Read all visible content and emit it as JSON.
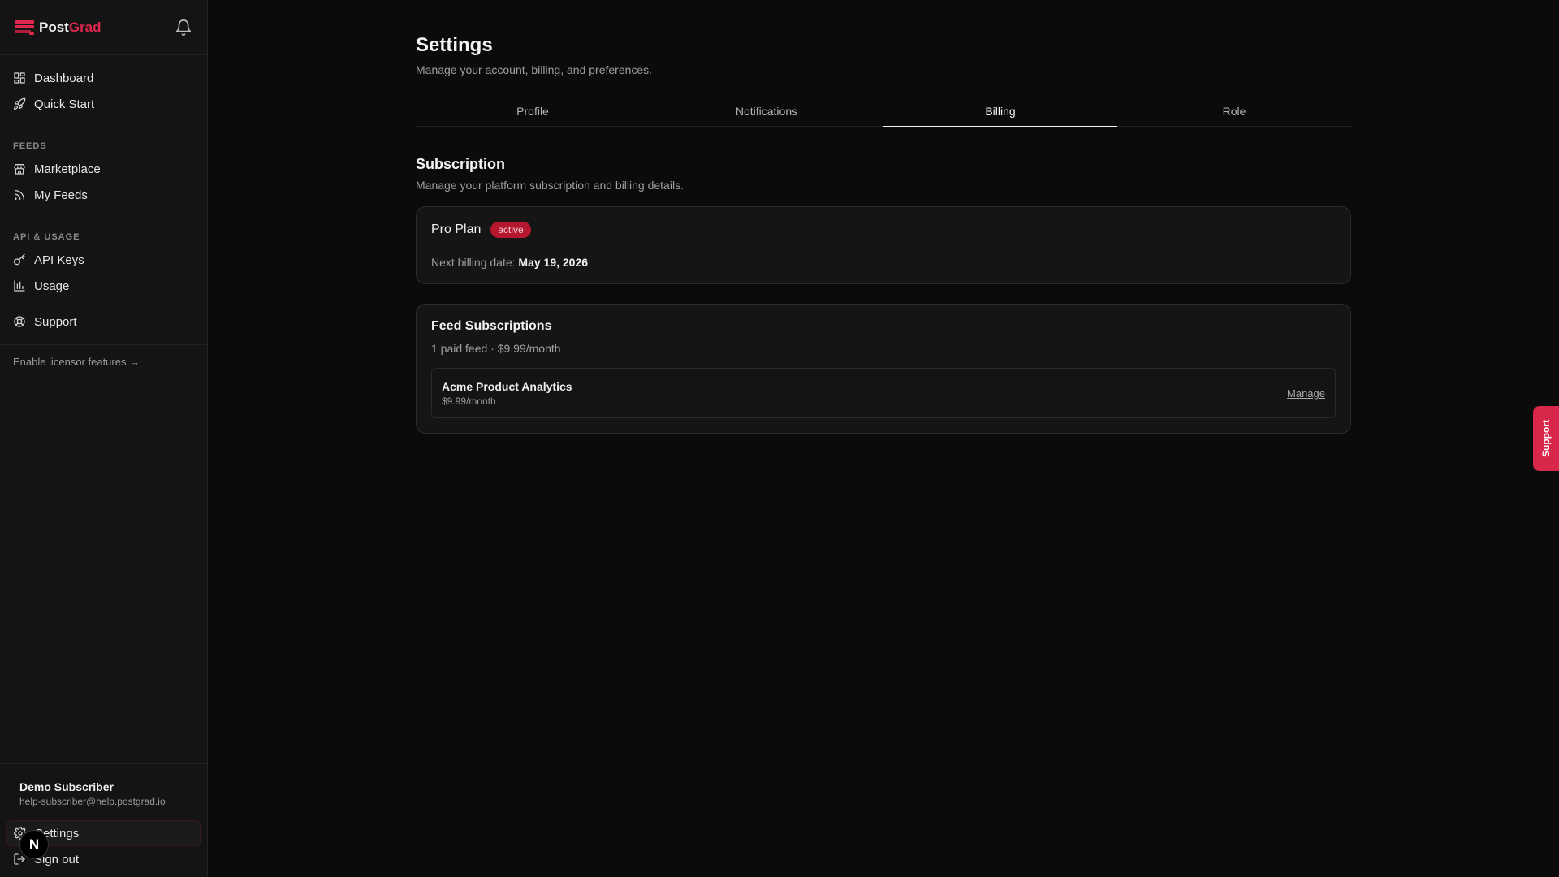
{
  "brand": {
    "name_part1": "Post",
    "name_part2": "Grad",
    "accent": "#e0284f"
  },
  "sidebar": {
    "top_items": [
      {
        "label": "Dashboard",
        "icon": "dashboard-icon"
      },
      {
        "label": "Quick Start",
        "icon": "rocket-icon"
      }
    ],
    "feeds_label": "FEEDS",
    "feeds_items": [
      {
        "label": "Marketplace",
        "icon": "store-icon"
      },
      {
        "label": "My Feeds",
        "icon": "rss-icon"
      }
    ],
    "api_label": "API & USAGE",
    "api_items": [
      {
        "label": "API Keys",
        "icon": "key-icon"
      },
      {
        "label": "Usage",
        "icon": "bar-chart-icon"
      }
    ],
    "support_label": "Support",
    "licensor_link": "Enable licensor features →",
    "user": {
      "name": "Demo Subscriber",
      "email": "help-subscriber@help.postgrad.io"
    },
    "settings_label": "Settings",
    "signout_label": "Sign out",
    "n_badge": "N"
  },
  "main": {
    "title": "Settings",
    "subtitle": "Manage your account, billing, and preferences.",
    "tabs": [
      {
        "label": "Profile",
        "active": false
      },
      {
        "label": "Notifications",
        "active": false
      },
      {
        "label": "Billing",
        "active": true
      },
      {
        "label": "Role",
        "active": false
      }
    ],
    "subscription": {
      "title": "Subscription",
      "subtitle": "Manage your platform subscription and billing details.",
      "plan_name": "Pro Plan",
      "status": "active",
      "next_billing_label": "Next billing date:",
      "next_billing_date": "May 19, 2026"
    },
    "feed_subscriptions": {
      "title": "Feed Subscriptions",
      "summary": "1 paid feed · $9.99/month",
      "items": [
        {
          "name": "Acme Product Analytics",
          "price": "$9.99/month",
          "action": "Manage"
        }
      ]
    }
  },
  "support_tab": "Support"
}
